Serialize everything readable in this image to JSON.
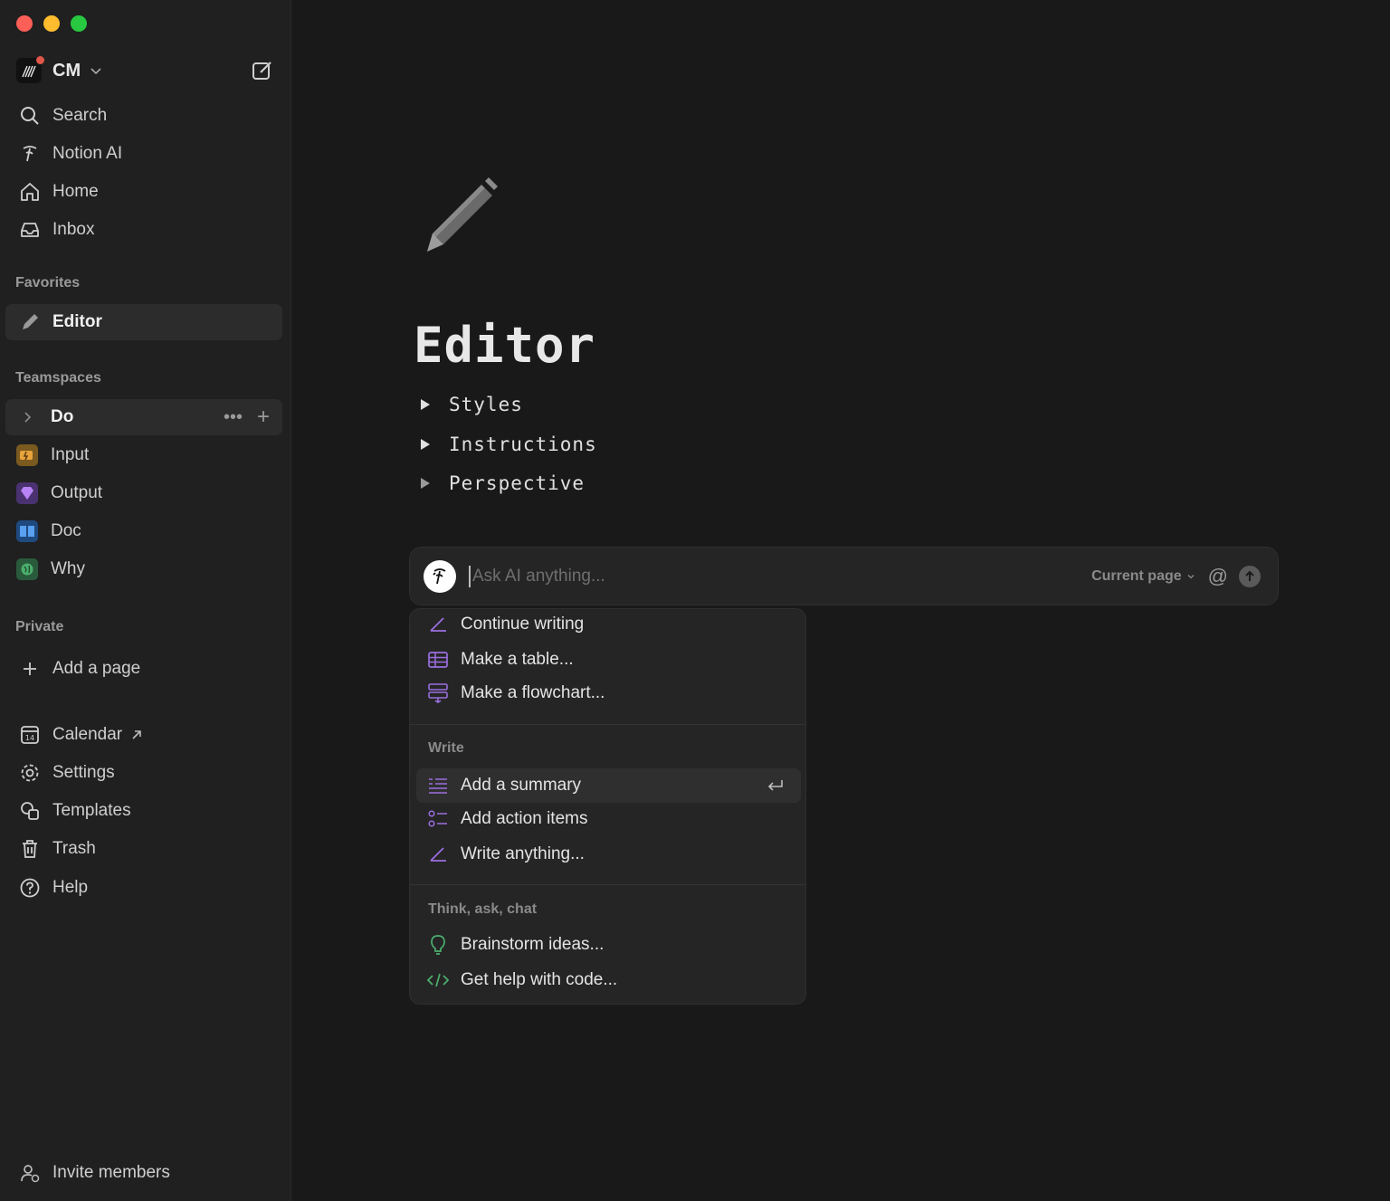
{
  "workspace": {
    "name": "CM"
  },
  "nav": {
    "search": "Search",
    "notion_ai": "Notion AI",
    "home": "Home",
    "inbox": "Inbox"
  },
  "favorites": {
    "label": "Favorites",
    "items": [
      {
        "label": "Editor"
      }
    ]
  },
  "teamspaces": {
    "label": "Teamspaces",
    "items": [
      {
        "label": "Do"
      },
      {
        "label": "Input"
      },
      {
        "label": "Output"
      },
      {
        "label": "Doc"
      },
      {
        "label": "Why"
      }
    ]
  },
  "private": {
    "label": "Private",
    "add_page": "Add a page"
  },
  "bottom_nav": {
    "calendar": "Calendar",
    "settings": "Settings",
    "templates": "Templates",
    "trash": "Trash",
    "help": "Help",
    "invite": "Invite members"
  },
  "page": {
    "title": "Editor",
    "toggles": [
      "Styles",
      "Instructions",
      "Perspective"
    ]
  },
  "ai": {
    "placeholder": "Ask AI anything...",
    "scope": "Current page",
    "mention_symbol": "@"
  },
  "menu": {
    "top_items": [
      "Continue writing",
      "Make a table...",
      "Make a flowchart..."
    ],
    "write_label": "Write",
    "write_items": [
      "Add a summary",
      "Add action items",
      "Write anything..."
    ],
    "think_label": "Think, ask, chat",
    "think_items": [
      "Brainstorm ideas...",
      "Get help with code..."
    ]
  },
  "colors": {
    "accent_purple": "#9b6fe0",
    "accent_green": "#4caf6e"
  }
}
